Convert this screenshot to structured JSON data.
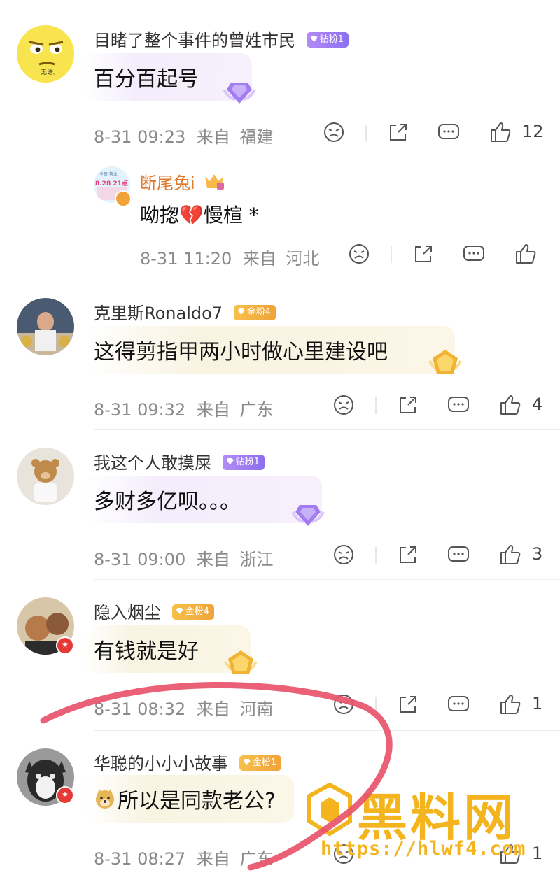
{
  "colors": {
    "accent_red": "#e8526a",
    "reply_name": "#e07a2c",
    "diamond_badge": "#a07cf2",
    "gold_badge": "#f2ae3e",
    "watermark": "#f3b41e"
  },
  "comments": [
    {
      "username": "目睹了整个事件的曾姓市民",
      "badge": "钻粉1",
      "badge_type": "diamond",
      "avatar_text": "无语。",
      "content": "百分百起号",
      "time": "8-31 09:23",
      "from": "来自",
      "location": "福建",
      "likes": "12",
      "reply": {
        "username": "断尾兔i",
        "avatar_text_1": "全员·营业",
        "avatar_text_2": "8.28 21点",
        "content": "呦揔💔慢楦 *",
        "time": "8-31 11:20",
        "from": "来自",
        "location": "河北",
        "likes": ""
      }
    },
    {
      "username": "克里斯Ronaldo7",
      "badge": "金粉4",
      "badge_type": "gold",
      "content": "这得剪指甲两小时做心里建设吧",
      "time": "8-31 09:32",
      "from": "来自",
      "location": "广东",
      "likes": "4"
    },
    {
      "username": "我这个人敢摸屎",
      "badge": "钻粉1",
      "badge_type": "diamond",
      "content": "多财多亿呗。。。",
      "time": "8-31 09:00",
      "from": "来自",
      "location": "浙江",
      "likes": "3"
    },
    {
      "username": "隐入烟尘",
      "badge": "金粉4",
      "badge_type": "gold",
      "content": "有钱就是好",
      "time": "8-31 08:32",
      "from": "来自",
      "location": "河南",
      "likes": "1"
    },
    {
      "username": "华聪的小小小故事",
      "badge": "金粉1",
      "badge_type": "gold",
      "content": "所以是同款老公?",
      "time": "8-31 08:27",
      "from": "来自",
      "location": "广东",
      "likes": "1"
    }
  ],
  "watermark": {
    "title": "黑料网",
    "url": "https://hlwf4.com"
  },
  "icons": [
    "sad-face-icon",
    "share-icon",
    "comment-icon",
    "thumbs-up-icon",
    "doge-emoji-icon",
    "broken-heart-emoji-icon"
  ]
}
